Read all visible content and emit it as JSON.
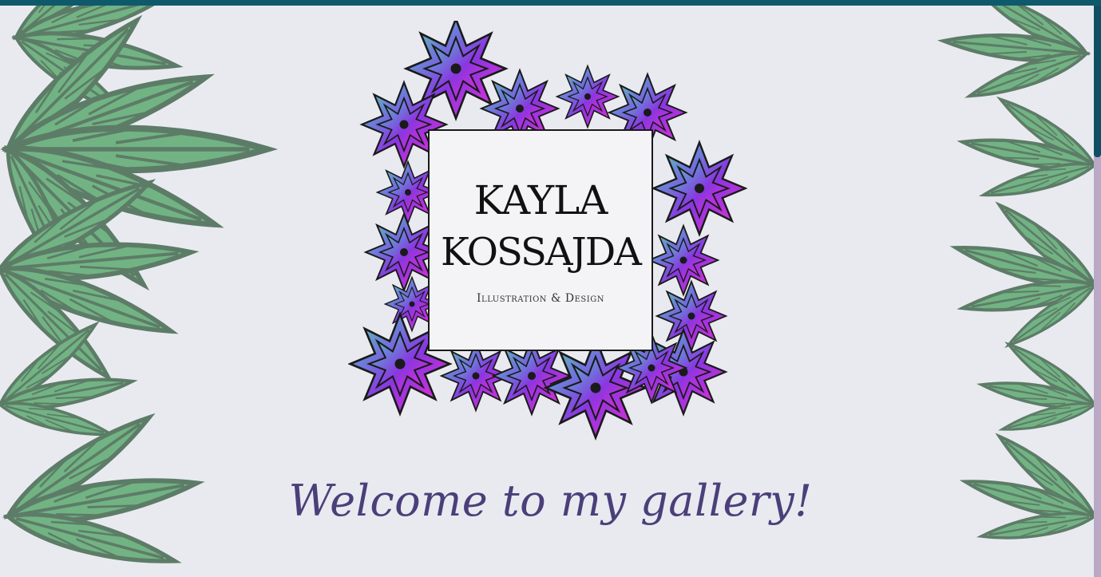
{
  "header": {
    "bar_color": "#0e5a6b"
  },
  "logo": {
    "name_line1": "KAYLA",
    "name_line2": "KOSSAJDA",
    "tagline": "Illustration & Design"
  },
  "hero": {
    "welcome_text": "Welcome to my gallery!"
  },
  "decor": {
    "left_foliage_icon": "leaf-cluster-icon",
    "right_foliage_icon": "leaf-cluster-icon",
    "flower_frame_icon": "dahlia-frame-icon"
  },
  "colors": {
    "background": "#e9eaf0",
    "foliage": "#6fae7e",
    "welcome": "#4b3f7a",
    "scrollbar_track": "#b9a9c6",
    "scrollbar_thumb": "#0f4f63"
  }
}
